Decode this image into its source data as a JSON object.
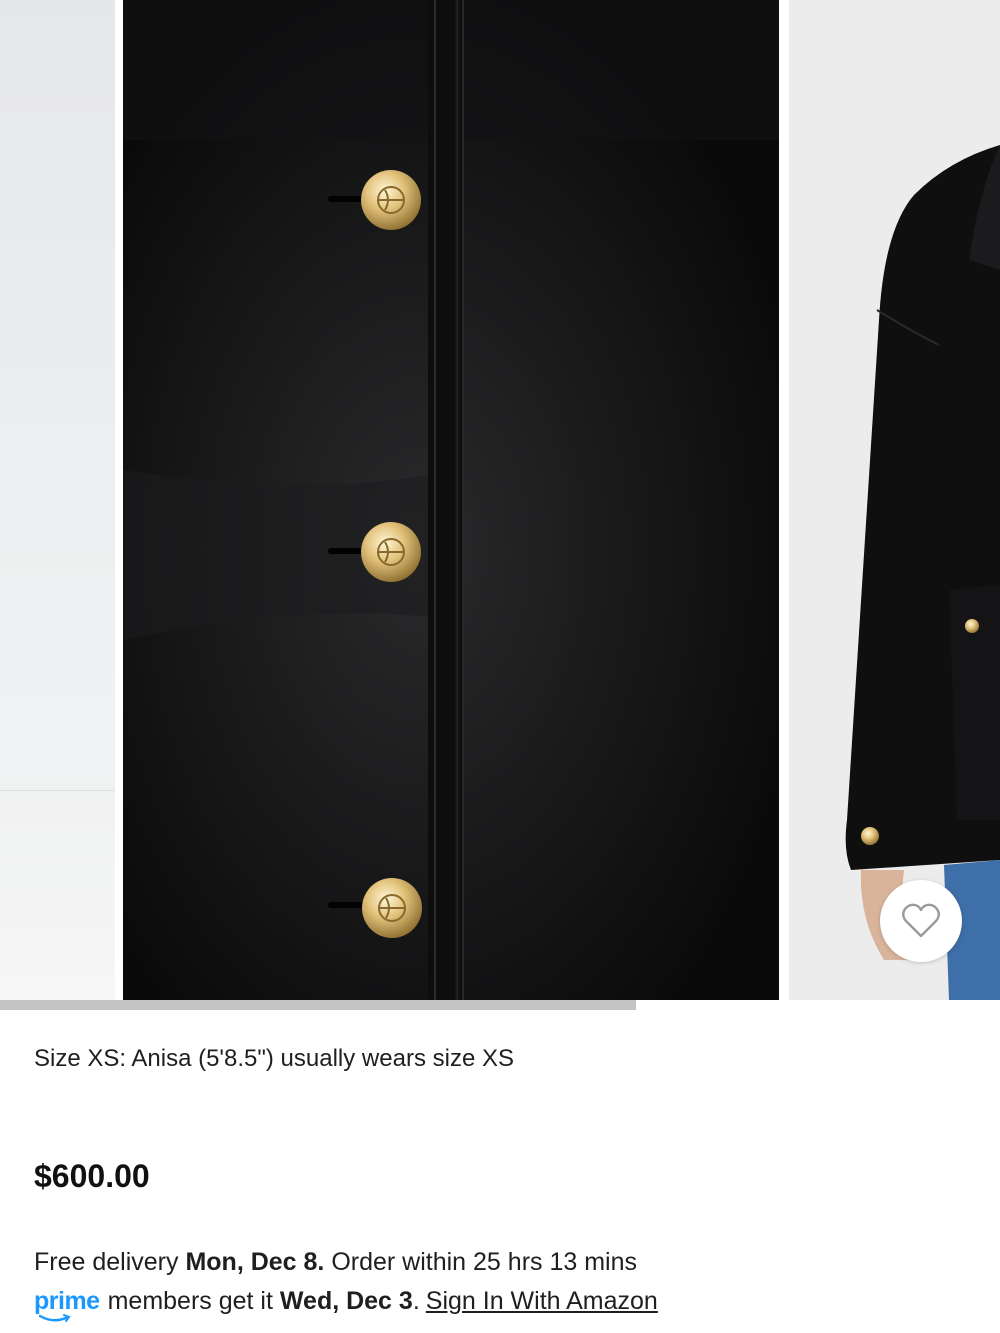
{
  "gallery": {
    "images": [
      {
        "name": "model-partial-left"
      },
      {
        "name": "jacket-button-placket-closeup"
      },
      {
        "name": "model-wearing-jacket-side"
      }
    ],
    "progress_fraction": 0.636,
    "heart_icon": "heart-outline-icon"
  },
  "product": {
    "size_note": "Size XS: Anisa (5'8.5\") usually wears size XS",
    "price": "$600.00"
  },
  "delivery": {
    "prefix": "Free delivery ",
    "date": "Mon, Dec 8.",
    "order_within": " Order within 25 hrs 13 mins",
    "prime_logo": "prime",
    "members_text": " members get it ",
    "prime_date": "Wed, Dec 3",
    "period": ".",
    "signin_link": "Sign In With Amazon"
  },
  "colors": {
    "prime_blue": "#1a98ff",
    "progress": "#c4c4c4"
  }
}
